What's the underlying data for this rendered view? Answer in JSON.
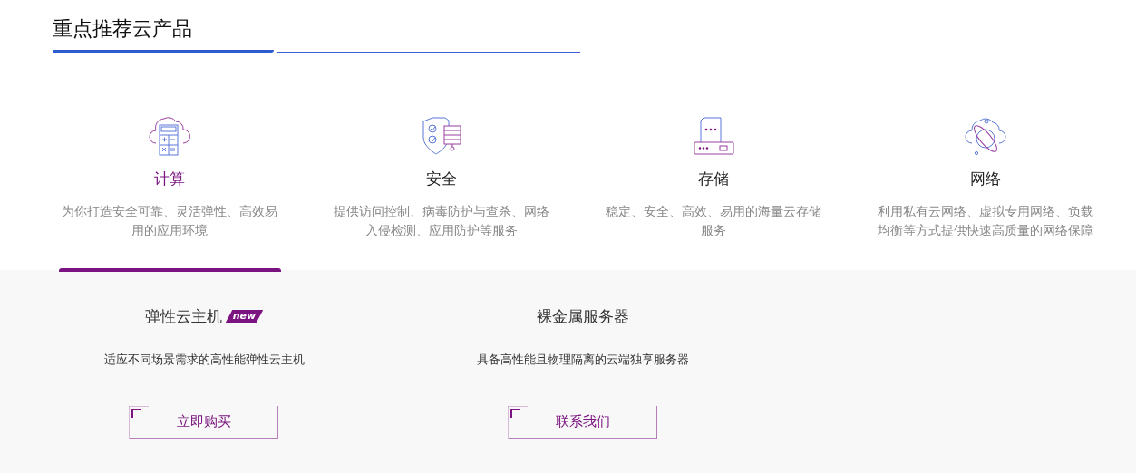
{
  "section_title": "重点推荐云产品",
  "categories": [
    {
      "kind": "compute",
      "label": "计算",
      "description": "为你打造安全可靠、灵活弹性、高效易用的应用环境",
      "selected": true
    },
    {
      "kind": "security",
      "label": "安全",
      "description": "提供访问控制、病毒防护与查杀、网络入侵检测、应用防护等服务",
      "selected": false
    },
    {
      "kind": "storage",
      "label": "存储",
      "description": "稳定、安全、高效、易用的海量云存储服务",
      "selected": false
    },
    {
      "kind": "network",
      "label": "网络",
      "description": "利用私有云网络、虚拟专用网络、负载均衡等方式提供快速高质量的网络保障",
      "selected": false
    }
  ],
  "products": [
    {
      "title": "弹性云主机",
      "badge": "new",
      "description": "适应不同场景需求的高性能弹性云主机",
      "button": "立即购买"
    },
    {
      "title": "裸金属服务器",
      "description": "具备高性能且物理隔离的云端独享服务器",
      "button": "联系我们"
    }
  ]
}
